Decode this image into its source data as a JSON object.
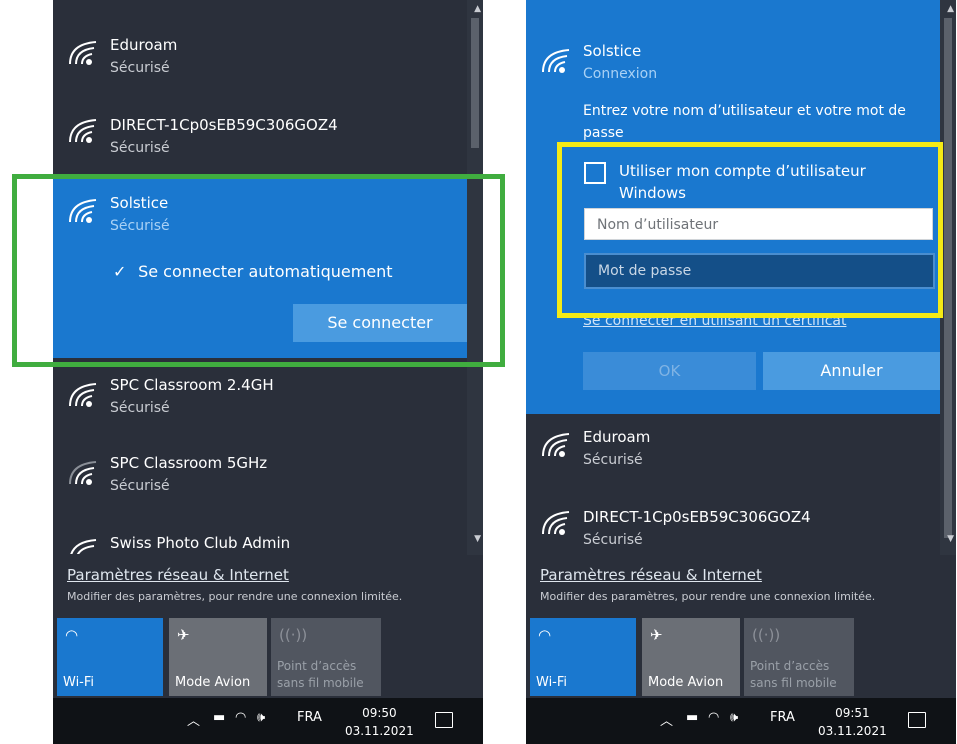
{
  "left": {
    "networks": [
      {
        "name": "Eduroam",
        "status": "Sécurisé"
      },
      {
        "name": "DIRECT-1Cp0sEB59C306GOZ4",
        "status": "Sécurisé"
      },
      {
        "name": "Solstice",
        "status": "Sécurisé",
        "auto_connect": "Se connecter automatiquement",
        "connect_button": "Se connecter"
      },
      {
        "name": "SPC Classroom 2.4GH",
        "status": "Sécurisé"
      },
      {
        "name": "SPC Classroom 5GHz",
        "status": "Sécurisé"
      },
      {
        "name": "Swiss Photo Club Admin",
        "status": ""
      }
    ],
    "time": "09:50",
    "date": "03.11.2021"
  },
  "right": {
    "selected": {
      "name": "Solstice",
      "status": "Connexion"
    },
    "prompt": "Entrez votre nom d’utilisateur et votre mot de passe",
    "windows_account_checkbox": "Utiliser mon compte d’utilisateur Windows",
    "username_placeholder": "Nom d’utilisateur",
    "password_placeholder": "Mot de passe",
    "certificate_link": "Se connecter en utilisant un certificat",
    "ok_button": "OK",
    "cancel_button": "Annuler",
    "networks": [
      {
        "name": "Eduroam",
        "status": "Sécurisé"
      },
      {
        "name": "DIRECT-1Cp0sEB59C306GOZ4",
        "status": "Sécurisé"
      }
    ],
    "time": "09:51",
    "date": "03.11.2021"
  },
  "common": {
    "settings_link": "Paramètres réseau & Internet",
    "settings_desc": "Modifier des paramètres, pour rendre une connexion limitée.",
    "tiles": {
      "wifi": "Wi-Fi",
      "avion": "Mode Avion",
      "hotspot_line1": "Point d’accès",
      "hotspot_line2": "sans fil mobile"
    },
    "language": "FRA"
  },
  "colors": {
    "accent_blue": "#1a78cf",
    "panel_bg": "#2a2f3a",
    "highlight_green": "#40ad3f",
    "highlight_yellow": "#f4ea15"
  },
  "icons": [
    "wifi-icon",
    "check-icon",
    "airplane-icon",
    "hotspot-icon",
    "chevron-up-icon",
    "battery-icon",
    "volume-icon",
    "notification-icon"
  ]
}
